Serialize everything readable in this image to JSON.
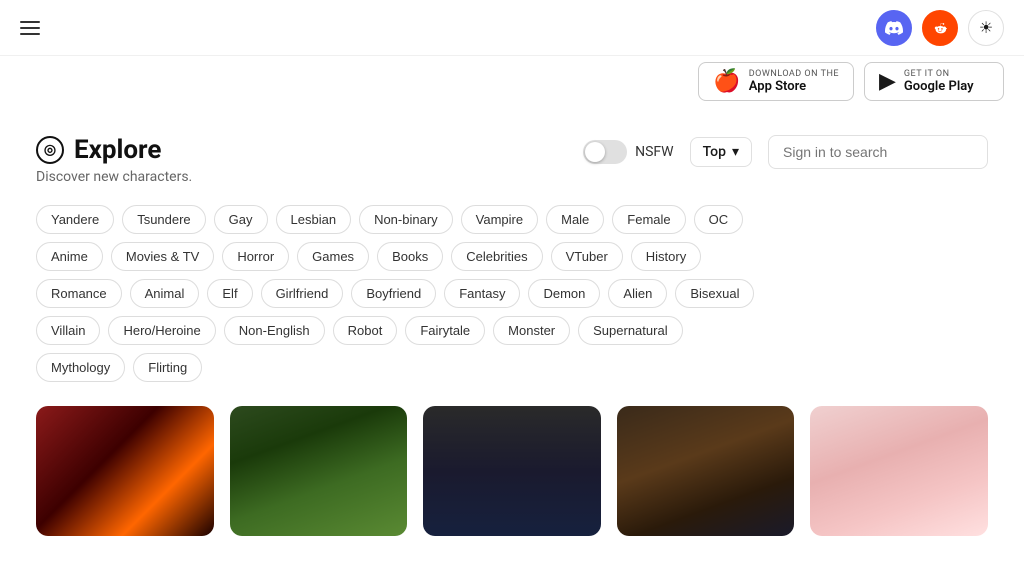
{
  "nav": {
    "discord_label": "Discord",
    "reddit_label": "Reddit",
    "theme_label": "Toggle theme"
  },
  "store": {
    "appstore": {
      "small": "Download on the",
      "name": "App Store"
    },
    "googleplay": {
      "small": "GET IT ON",
      "name": "Google Play"
    }
  },
  "explore": {
    "icon": "◎",
    "title": "Explore",
    "subtitle": "Discover new characters.",
    "nsfw_label": "NSFW",
    "top_label": "Top",
    "search_placeholder": "Sign in to search"
  },
  "tags": {
    "row1": [
      "Yandere",
      "Tsundere",
      "Gay",
      "Lesbian",
      "Non-binary",
      "Vampire",
      "Male",
      "Female",
      "OC"
    ],
    "row2": [
      "Anime",
      "Movies & TV",
      "Horror",
      "Games",
      "Books",
      "Celebrities",
      "VTuber",
      "History"
    ],
    "row3": [
      "Romance",
      "Animal",
      "Elf",
      "Girlfriend",
      "Boyfriend",
      "Fantasy",
      "Demon",
      "Alien",
      "Bisexual"
    ],
    "row4": [
      "Villain",
      "Hero/Heroine",
      "Non-English",
      "Robot",
      "Fairytale",
      "Monster",
      "Supernatural"
    ],
    "row5": [
      "Mythology",
      "Flirting"
    ]
  },
  "cards": [
    {
      "id": 1,
      "style": "card-1"
    },
    {
      "id": 2,
      "style": "card-2"
    },
    {
      "id": 3,
      "style": "card-3"
    },
    {
      "id": 4,
      "style": "card-4"
    },
    {
      "id": 5,
      "style": "card-5"
    }
  ]
}
